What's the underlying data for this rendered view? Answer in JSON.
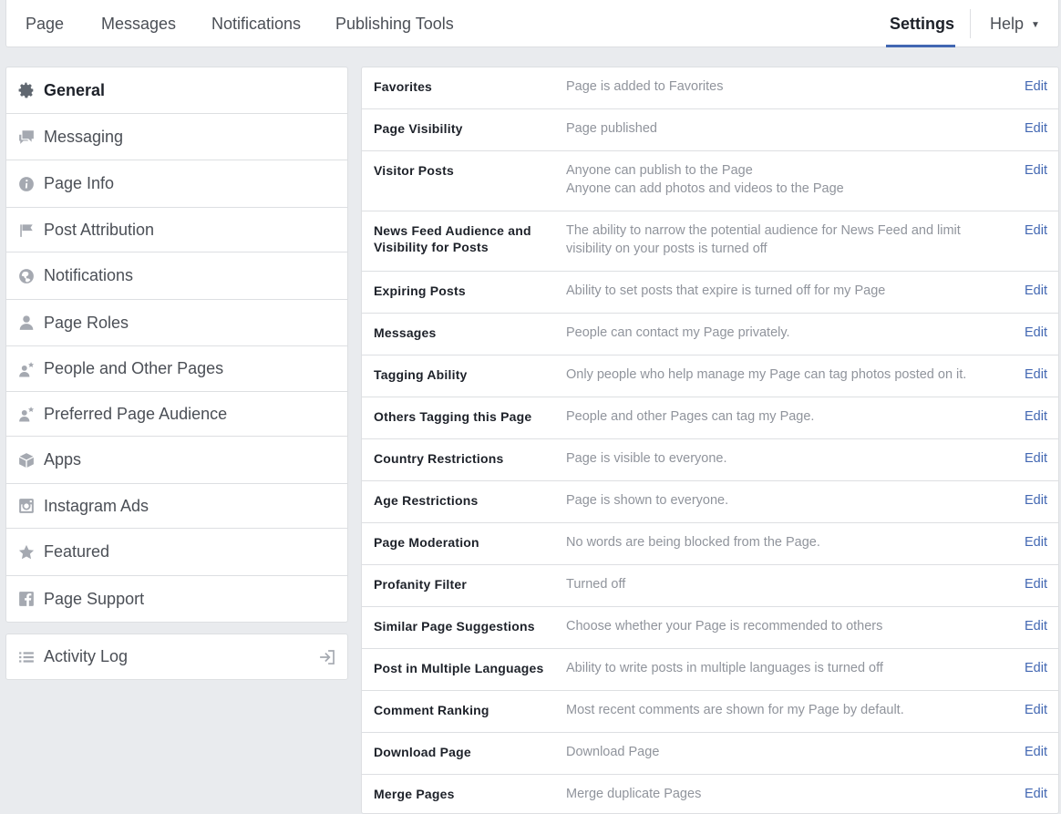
{
  "topnav": {
    "tabs": [
      "Page",
      "Messages",
      "Notifications",
      "Publishing Tools"
    ],
    "settings": "Settings",
    "help": "Help",
    "accent": "#4267b2"
  },
  "sidebar": {
    "items": [
      {
        "label": "General",
        "icon": "gear-icon"
      },
      {
        "label": "Messaging",
        "icon": "messaging-icon"
      },
      {
        "label": "Page Info",
        "icon": "info-icon"
      },
      {
        "label": "Post Attribution",
        "icon": "flag-icon"
      },
      {
        "label": "Notifications",
        "icon": "globe-icon"
      },
      {
        "label": "Page Roles",
        "icon": "person-icon"
      },
      {
        "label": "People and Other Pages",
        "icon": "person-star-icon"
      },
      {
        "label": "Preferred Page Audience",
        "icon": "person-star-icon"
      },
      {
        "label": "Apps",
        "icon": "cube-icon"
      },
      {
        "label": "Instagram Ads",
        "icon": "instagram-icon"
      },
      {
        "label": "Featured",
        "icon": "star-icon"
      },
      {
        "label": "Page Support",
        "icon": "facebook-icon"
      }
    ],
    "activity_log": "Activity Log"
  },
  "settings": {
    "edit_label": "Edit",
    "rows": [
      {
        "label": "Favorites",
        "value": [
          "Page is added to Favorites"
        ]
      },
      {
        "label": "Page Visibility",
        "value": [
          "Page published"
        ]
      },
      {
        "label": "Visitor Posts",
        "value": [
          "Anyone can publish to the Page",
          "Anyone can add photos and videos to the Page"
        ]
      },
      {
        "label": "News Feed Audience and Visibility for Posts",
        "value": [
          "The ability to narrow the potential audience for News Feed and limit visibility on your posts is turned off"
        ]
      },
      {
        "label": "Expiring Posts",
        "value": [
          "Ability to set posts that expire is turned off for my Page"
        ]
      },
      {
        "label": "Messages",
        "value": [
          "People can contact my Page privately."
        ]
      },
      {
        "label": "Tagging Ability",
        "value": [
          "Only people who help manage my Page can tag photos posted on it."
        ]
      },
      {
        "label": "Others Tagging this Page",
        "value": [
          "People and other Pages can tag my Page."
        ]
      },
      {
        "label": "Country Restrictions",
        "value": [
          "Page is visible to everyone."
        ]
      },
      {
        "label": "Age Restrictions",
        "value": [
          "Page is shown to everyone."
        ]
      },
      {
        "label": "Page Moderation",
        "value": [
          "No words are being blocked from the Page."
        ]
      },
      {
        "label": "Profanity Filter",
        "value": [
          "Turned off"
        ]
      },
      {
        "label": "Similar Page Suggestions",
        "value": [
          "Choose whether your Page is recommended to others"
        ]
      },
      {
        "label": "Post in Multiple Languages",
        "value": [
          "Ability to write posts in multiple languages is turned off"
        ]
      },
      {
        "label": "Comment Ranking",
        "value": [
          "Most recent comments are shown for my Page by default."
        ]
      },
      {
        "label": "Download Page",
        "value": [
          "Download Page"
        ]
      },
      {
        "label": "Merge Pages",
        "value": [
          "Merge duplicate Pages"
        ]
      }
    ]
  }
}
